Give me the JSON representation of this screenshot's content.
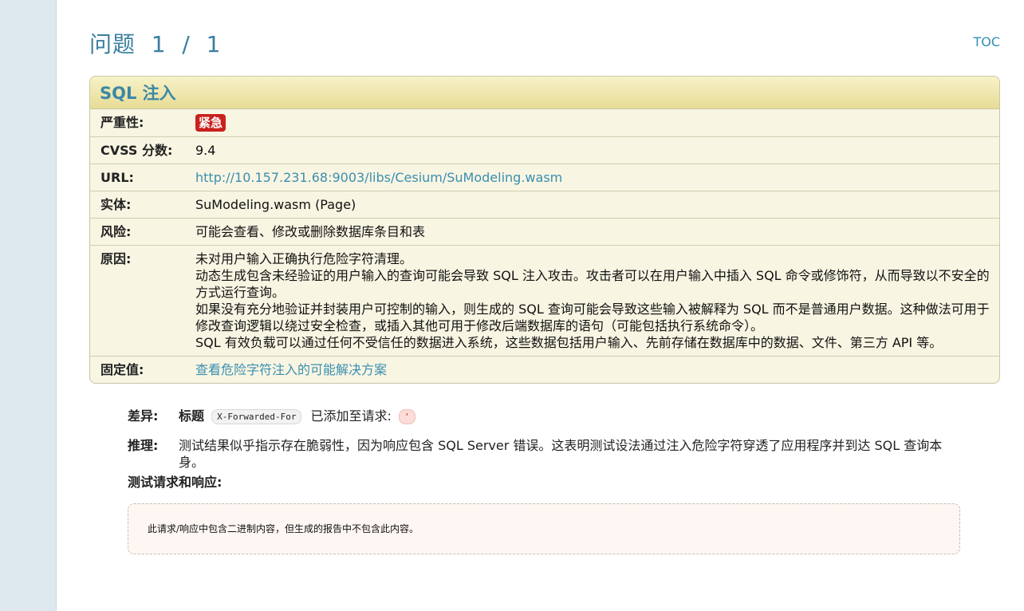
{
  "page": {
    "title": "问题  1  /  1",
    "toc_label": "TOC"
  },
  "issue": {
    "title": "SQL 注入",
    "rows": {
      "severity": {
        "label": "严重性:",
        "value": "紧急"
      },
      "cvss": {
        "label": "CVSS 分数:",
        "value": "9.4"
      },
      "url": {
        "label": "URL:",
        "value": "http://10.157.231.68:9003/libs/Cesium/SuModeling.wasm"
      },
      "entity": {
        "label": "实体:",
        "value": "SuModeling.wasm (Page)"
      },
      "risk": {
        "label": "风险:",
        "value": "可能会查看、修改或删除数据库条目和表"
      },
      "cause": {
        "label": "原因:",
        "lines": [
          "未对用户输入正确执行危险字符清理。",
          "动态生成包含未经验证的用户输入的查询可能会导致 SQL 注入攻击。攻击者可以在用户输入中插入 SQL 命令或修饰符，从而导致以不安全的方式运行查询。",
          "如果没有充分地验证并封装用户可控制的输入，则生成的 SQL 查询可能会导致这些输入被解释为 SQL 而不是普通用户数据。这种做法可用于修改查询逻辑以绕过安全检查，或插入其他可用于修改后端数据库的语句（可能包括执行系统命令）。",
          "SQL 有效负载可以通过任何不受信任的数据进入系统，这些数据包括用户输入、先前存储在数据库中的数据、文件、第三方 API 等。"
        ]
      },
      "fix": {
        "label": "固定值:",
        "value": "查看危险字符注入的可能解决方案"
      }
    }
  },
  "details": {
    "diff": {
      "label": "差异:",
      "prefix": "标题",
      "header_name": "X-Forwarded-For",
      "middle": "已添加至请求:",
      "payload": "'"
    },
    "reasoning": {
      "label": "推理:",
      "text": "测试结果似乎指示存在脆弱性，因为响应包含 SQL Server 错误。这表明测试设法通过注入危险字符穿透了应用程序并到达 SQL 查询本身。"
    },
    "test_section_label": "测试请求和响应:",
    "binary_notice": "此请求/响应中包含二进制内容，但生成的报告中不包含此内容。"
  },
  "colors": {
    "accent": "#3a87a7",
    "severity_badge": "#c9211e",
    "table_background": "#f8f5e2",
    "rail": "#dde9ee"
  }
}
